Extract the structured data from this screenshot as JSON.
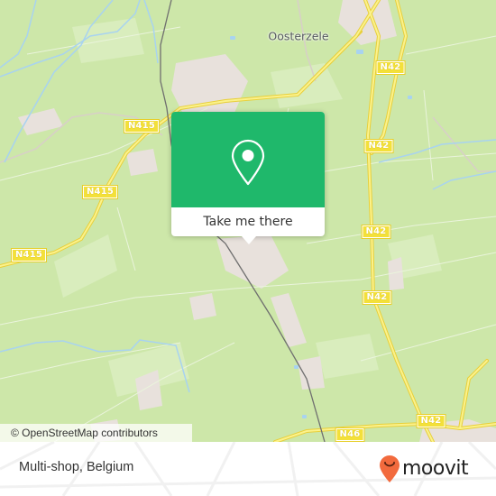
{
  "map": {
    "town_labels": [
      {
        "name": "Oosterzele"
      }
    ],
    "road_labels": [
      {
        "ref": "N42"
      },
      {
        "ref": "N415"
      },
      {
        "ref": "N42"
      },
      {
        "ref": "N415"
      },
      {
        "ref": "N415"
      },
      {
        "ref": "N42"
      },
      {
        "ref": "N42"
      },
      {
        "ref": "N42"
      },
      {
        "ref": "N46"
      }
    ],
    "attribution": "© OpenStreetMap contributors",
    "colors": {
      "land": "#cde7a9",
      "road": "#f3e03a",
      "water": "#a8d3f0",
      "railway": "#6f6f6f",
      "builtup": "#e8e1dc"
    }
  },
  "popup": {
    "icon": "map-pin-icon",
    "action_label": "Take me there",
    "accent_color": "#1fb86b"
  },
  "footer": {
    "place_name": "Multi-shop, Belgium",
    "logo_text": "moovit",
    "logo_icon": "moovit-smile-pin-icon",
    "logo_color": "#f26a3d"
  }
}
